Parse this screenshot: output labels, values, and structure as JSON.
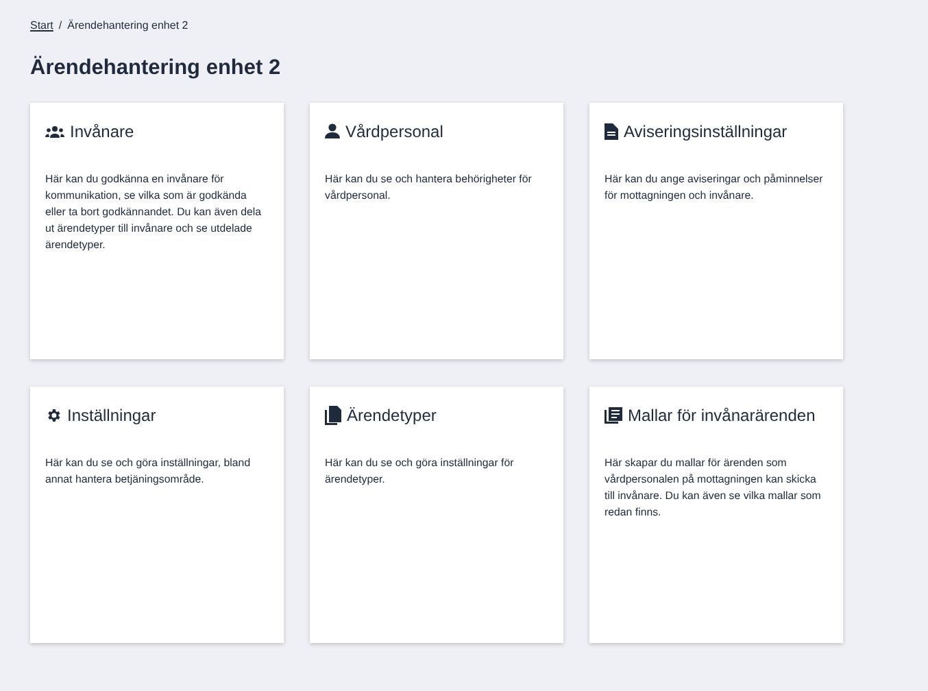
{
  "breadcrumb": {
    "separator": "/",
    "items": [
      {
        "label": "Start",
        "kind": "link"
      },
      {
        "label": "Ärendehantering enhet 2",
        "kind": "current"
      }
    ]
  },
  "title": "Ärendehantering enhet 2",
  "cards": [
    {
      "kind": "people",
      "title": "Invånare",
      "text": "Här kan du godkänna en invånare för kommunikation, se vilka som är godkända eller ta bort godkännandet. Du kan även dela ut ärendetyper till invånare och se utdelade ärendetyper."
    },
    {
      "kind": "person",
      "title": "Vårdpersonal",
      "text": "Här kan du se och hantera behörigheter för vårdpersonal."
    },
    {
      "kind": "document",
      "title": "Aviseringsinställningar",
      "text": "Här kan du ange aviseringar och påminnelser för mottagningen och invånare."
    },
    {
      "kind": "gear",
      "title": "Inställningar",
      "text": "Här kan du se och göra inställningar, bland annat hantera betjäningsområde."
    },
    {
      "kind": "documents",
      "title": "Ärendetyper",
      "text": "Här kan du se och göra inställningar för ärendetyper."
    },
    {
      "kind": "list",
      "title": "Mallar för invånarärenden",
      "text": "Här skapar du mallar för ärenden som vårdpersonalen på mottagningen kan skicka till invånare. Du kan även se vilka mallar som redan finns."
    }
  ]
}
